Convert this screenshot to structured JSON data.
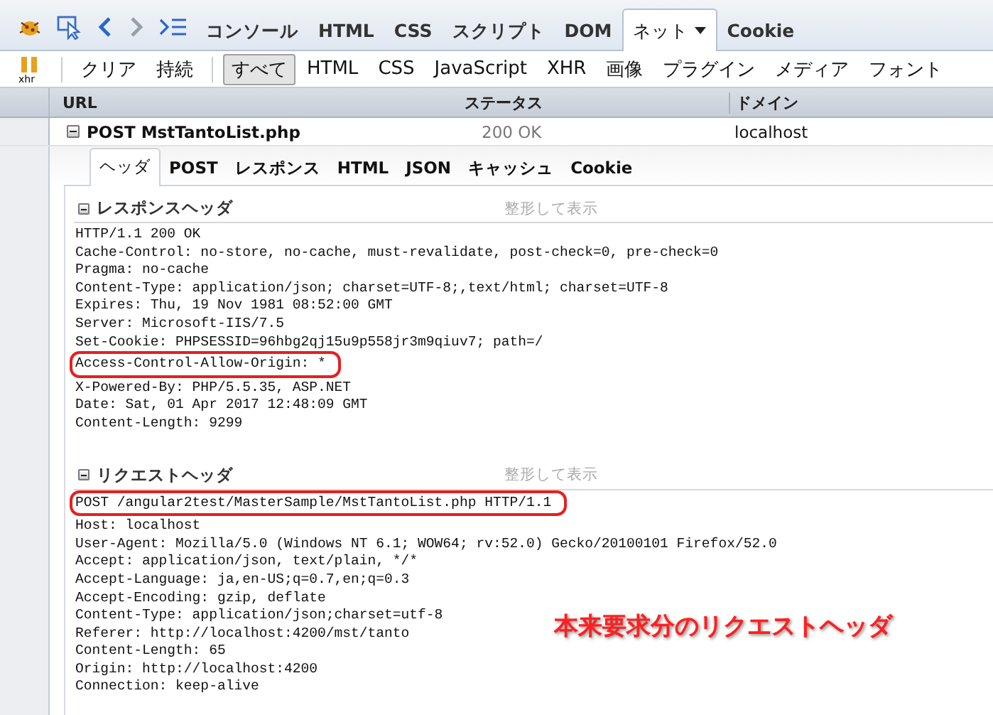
{
  "toolbar": {
    "tabs": [
      {
        "label": "コンソール",
        "selected": false
      },
      {
        "label": "HTML",
        "selected": false
      },
      {
        "label": "CSS",
        "selected": false
      },
      {
        "label": "スクリプト",
        "selected": false
      },
      {
        "label": "DOM",
        "selected": false
      },
      {
        "label": "ネット",
        "selected": true,
        "dropdown": true
      },
      {
        "label": "Cookie",
        "selected": false
      }
    ]
  },
  "filter_bar": {
    "xhr_icon_label": "xhr",
    "actions": [
      "クリア",
      "持続"
    ],
    "filters": [
      {
        "label": "すべて",
        "selected": true
      },
      {
        "label": "HTML",
        "selected": false
      },
      {
        "label": "CSS",
        "selected": false
      },
      {
        "label": "JavaScript",
        "selected": false
      },
      {
        "label": "XHR",
        "selected": false
      },
      {
        "label": "画像",
        "selected": false
      },
      {
        "label": "プラグイン",
        "selected": false
      },
      {
        "label": "メディア",
        "selected": false
      },
      {
        "label": "フォント",
        "selected": false
      }
    ]
  },
  "table": {
    "columns": [
      "URL",
      "ステータス",
      "ドメイン"
    ],
    "rows": [
      {
        "url": "POST MstTantoList.php",
        "status": "200 OK",
        "domain": "localhost",
        "expanded": true
      }
    ]
  },
  "detail_tabs": [
    {
      "label": "ヘッダ",
      "selected": true
    },
    {
      "label": "POST",
      "selected": false
    },
    {
      "label": "レスポンス",
      "selected": false
    },
    {
      "label": "HTML",
      "selected": false
    },
    {
      "label": "JSON",
      "selected": false
    },
    {
      "label": "キャッシュ",
      "selected": false
    },
    {
      "label": "Cookie",
      "selected": false
    }
  ],
  "sections": [
    {
      "title": "レスポンスヘッダ",
      "pretty_link": "整形して表示",
      "lines": [
        {
          "text": "HTTP/1.1 200 OK",
          "highlighted": false
        },
        {
          "text": "Cache-Control: no-store, no-cache, must-revalidate, post-check=0, pre-check=0",
          "highlighted": false
        },
        {
          "text": "Pragma: no-cache",
          "highlighted": false
        },
        {
          "text": "Content-Type: application/json; charset=UTF-8;,text/html; charset=UTF-8",
          "highlighted": false
        },
        {
          "text": "Expires: Thu, 19 Nov 1981 08:52:00 GMT",
          "highlighted": false
        },
        {
          "text": "Server: Microsoft-IIS/7.5",
          "highlighted": false
        },
        {
          "text": "Set-Cookie: PHPSESSID=96hbg2qj15u9p558jr3m9qiuv7; path=/",
          "highlighted": false
        },
        {
          "text": "Access-Control-Allow-Origin: *",
          "highlighted": true
        },
        {
          "text": "X-Powered-By: PHP/5.5.35, ASP.NET",
          "highlighted": false
        },
        {
          "text": "Date: Sat, 01 Apr 2017 12:48:09 GMT",
          "highlighted": false
        },
        {
          "text": "Content-Length: 9299",
          "highlighted": false
        }
      ]
    },
    {
      "title": "リクエストヘッダ",
      "pretty_link": "整形して表示",
      "lines": [
        {
          "text": "POST /angular2test/MasterSample/MstTantoList.php HTTP/1.1",
          "highlighted": true
        },
        {
          "text": "Host: localhost",
          "highlighted": false
        },
        {
          "text": "User-Agent: Mozilla/5.0 (Windows NT 6.1; WOW64; rv:52.0) Gecko/20100101 Firefox/52.0",
          "highlighted": false
        },
        {
          "text": "Accept: application/json, text/plain, */*",
          "highlighted": false
        },
        {
          "text": "Accept-Language: ja,en-US;q=0.7,en;q=0.3",
          "highlighted": false
        },
        {
          "text": "Accept-Encoding: gzip, deflate",
          "highlighted": false
        },
        {
          "text": "Content-Type: application/json;charset=utf-8",
          "highlighted": false
        },
        {
          "text": "Referer: http://localhost:4200/mst/tanto",
          "highlighted": false
        },
        {
          "text": "Content-Length: 65",
          "highlighted": false
        },
        {
          "text": "Origin: http://localhost:4200",
          "highlighted": false
        },
        {
          "text": "Connection: keep-alive",
          "highlighted": false
        }
      ]
    }
  ],
  "annotation": "本来要求分のリクエストヘッダ"
}
